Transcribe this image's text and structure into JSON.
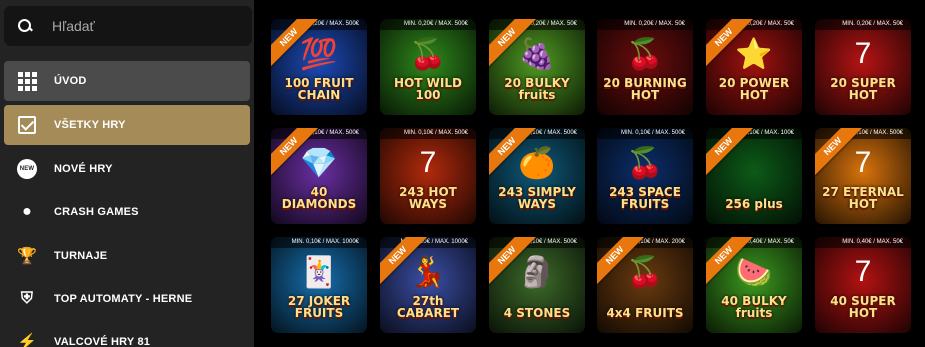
{
  "search": {
    "placeholder": "Hľadať"
  },
  "nav": [
    {
      "label": "ÚVOD",
      "icon": "grid-icon"
    },
    {
      "label": "VŠETKY HRY",
      "icon": "checkbox-icon"
    },
    {
      "label": "NOVÉ HRY",
      "icon": "new-badge-icon",
      "badge": "NEW"
    },
    {
      "label": "CRASH GAMES",
      "icon": "bomb-icon"
    },
    {
      "label": "TURNAJE",
      "icon": "trophy-icon"
    },
    {
      "label": "TOP AUTOMATY - HERNE",
      "icon": "shield-icon"
    },
    {
      "label": "VALCOVÉ HRY 81",
      "icon": "lightning-icon"
    }
  ],
  "colors": {
    "sidebar": "#232323",
    "active_item": "#4b4b4b",
    "selected_item": "#a48b58",
    "ribbon": "#e8770e"
  },
  "games": [
    {
      "title": "100 FRUIT CHAIN",
      "limits": "MIN. 0,20€ / MAX. 500€",
      "new": "NEW",
      "bg": "#1d4bb8",
      "art": "💯"
    },
    {
      "title": "HOT WILD 100",
      "limits": "MIN. 0,20€ / MAX. 500€",
      "new": "",
      "bg": "#2f8a1c",
      "art": "🍒"
    },
    {
      "title": "20 BULKY fruits",
      "limits": "MIN. 0,20€ / MAX. 50€",
      "new": "NEW",
      "bg": "#4f9b22",
      "art": "🍇"
    },
    {
      "title": "20 BURNING HOT",
      "limits": "MIN. 0,20€ / MAX. 50€",
      "new": "",
      "bg": "#6e0d0d",
      "art": "🍒"
    },
    {
      "title": "20 POWER HOT",
      "limits": "MIN. 0,20€ / MAX. 50€",
      "new": "NEW",
      "bg": "#a1120f",
      "art": "⭐"
    },
    {
      "title": "20 SUPER HOT",
      "limits": "MIN. 0,20€ / MAX. 50€",
      "new": "",
      "bg": "#b41414",
      "art": "7"
    },
    {
      "title": "40 DIAMONDS",
      "limits": "MIN. 0,10€ / MAX. 500€",
      "new": "NEW",
      "bg": "#6a2fa3",
      "art": "💎"
    },
    {
      "title": "243 HOT WAYS",
      "limits": "MIN. 0,10€ / MAX. 500€",
      "new": "",
      "bg": "#b22a0c",
      "art": "7"
    },
    {
      "title": "243 SIMPLY WAYS",
      "limits": "MIN. 0,10€ / MAX. 500€",
      "new": "NEW",
      "bg": "#0f5a7a",
      "art": "🍊"
    },
    {
      "title": "243 SPACE FRUITS",
      "limits": "MIN. 0,10€ / MAX. 500€",
      "new": "",
      "bg": "#0c2f6b",
      "art": "🍒"
    },
    {
      "title": "256 plus",
      "limits": "MIN. 0,10€ / MAX. 100€",
      "new": "NEW",
      "bg": "#0d5b18",
      "art": ""
    },
    {
      "title": "27 ETERNAL HOT",
      "limits": "MIN. 0,10€ / MAX. 500€",
      "new": "NEW",
      "bg": "#d8730c",
      "art": "7"
    },
    {
      "title": "27 JOKER FRUITS",
      "limits": "MIN. 0,10€ / MAX. 1000€",
      "new": "",
      "bg": "#1670b0",
      "art": "🃏"
    },
    {
      "title": "27th CABARET",
      "limits": "MIN. 0,10€ / MAX. 1000€",
      "new": "NEW",
      "bg": "#3b4fa6",
      "art": "💃"
    },
    {
      "title": "4 STONES",
      "limits": "MIN. 0,10€ / MAX. 500€",
      "new": "NEW",
      "bg": "#3d6b2a",
      "art": "🗿"
    },
    {
      "title": "4x4 FRUITS",
      "limits": "MIN. 0,10€ / MAX. 200€",
      "new": "NEW",
      "bg": "#6a3b0f",
      "art": "🍒"
    },
    {
      "title": "40 BULKY fruits",
      "limits": "MIN. 0,40€ / MAX. 50€",
      "new": "NEW",
      "bg": "#3c9a1f",
      "art": "🍉"
    },
    {
      "title": "40 SUPER HOT",
      "limits": "MIN. 0,40€ / MAX. 50€",
      "new": "",
      "bg": "#b31212",
      "art": "7"
    }
  ]
}
